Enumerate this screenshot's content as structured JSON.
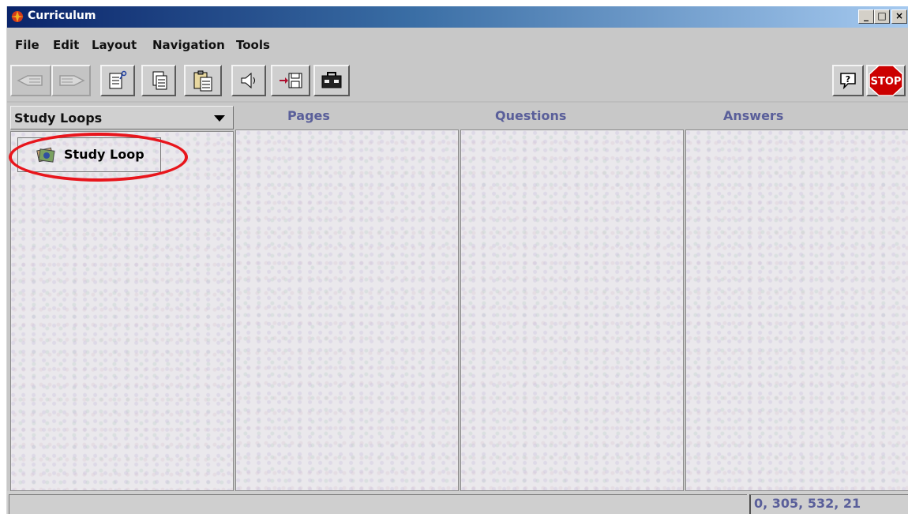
{
  "window": {
    "title": "Curriculum",
    "controls": {
      "minimize": "_",
      "maximize": "□",
      "close": "×"
    }
  },
  "menu": [
    "File",
    "Edit",
    "Layout",
    "Navigation",
    "Tools"
  ],
  "toolbar": {
    "buttons": [
      {
        "icon": "hand-back-icon",
        "enabled": false
      },
      {
        "icon": "hand-forward-icon",
        "enabled": false
      },
      {
        "icon": "edit-document-icon",
        "enabled": true
      },
      {
        "icon": "copy-icon",
        "enabled": true
      },
      {
        "icon": "paste-icon",
        "enabled": true
      },
      {
        "icon": "speaker-icon",
        "enabled": true
      },
      {
        "icon": "save-icon",
        "enabled": true
      },
      {
        "icon": "toolbox-icon",
        "enabled": true
      }
    ],
    "help_icon": "help-icon",
    "stop_label": "STOP",
    "stop_color": "#cc0000"
  },
  "left_panel": {
    "selector_value": "Study Loops",
    "items": [
      {
        "label": "Study Loop",
        "icon": "study-loop-icon"
      }
    ]
  },
  "columns": [
    "Pages",
    "Questions",
    "Answers"
  ],
  "status": {
    "left": "",
    "right": "0, 305, 532, 21"
  },
  "colors": {
    "title_gradient_start": "#0a246a",
    "header_text": "#5a5f9a",
    "highlight": "#e8151c"
  }
}
